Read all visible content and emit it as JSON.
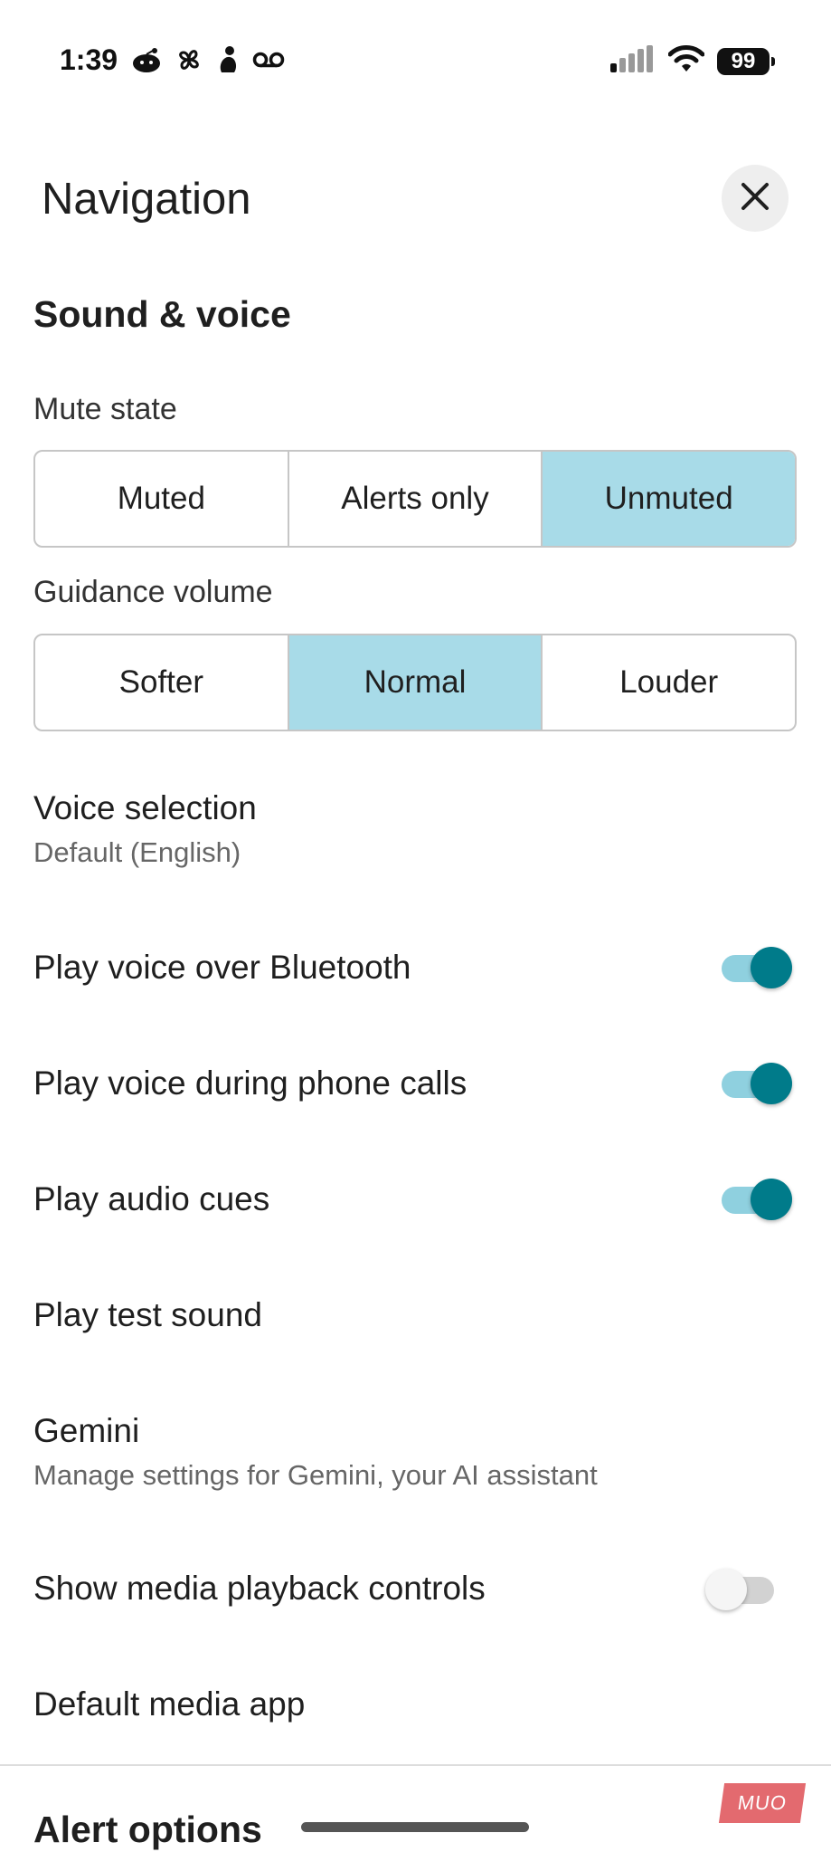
{
  "status_bar": {
    "time": "1:39",
    "battery": "99"
  },
  "header": {
    "title": "Navigation"
  },
  "section": {
    "title": "Sound & voice"
  },
  "mute_state": {
    "label": "Mute state",
    "options": [
      "Muted",
      "Alerts only",
      "Unmuted"
    ],
    "selected": "Unmuted"
  },
  "guidance_volume": {
    "label": "Guidance volume",
    "options": [
      "Softer",
      "Normal",
      "Louder"
    ],
    "selected": "Normal"
  },
  "voice_selection": {
    "title": "Voice selection",
    "value": "Default (English)"
  },
  "toggles": {
    "bluetooth": {
      "label": "Play voice over Bluetooth",
      "on": true
    },
    "phone_calls": {
      "label": "Play voice during phone calls",
      "on": true
    },
    "audio_cues": {
      "label": "Play audio cues",
      "on": true
    },
    "media_controls": {
      "label": "Show media playback controls",
      "on": false
    }
  },
  "test_sound": {
    "label": "Play test sound"
  },
  "gemini": {
    "title": "Gemini",
    "subtitle": "Manage settings for Gemini, your AI assistant"
  },
  "default_media_app": {
    "label": "Default media app"
  },
  "next_section": {
    "title": "Alert options"
  },
  "watermark": "MUO",
  "colors": {
    "selected_segment": "#a8dbe8",
    "toggle_thumb_on": "#007b8a",
    "toggle_track_on": "#8fd0df"
  }
}
